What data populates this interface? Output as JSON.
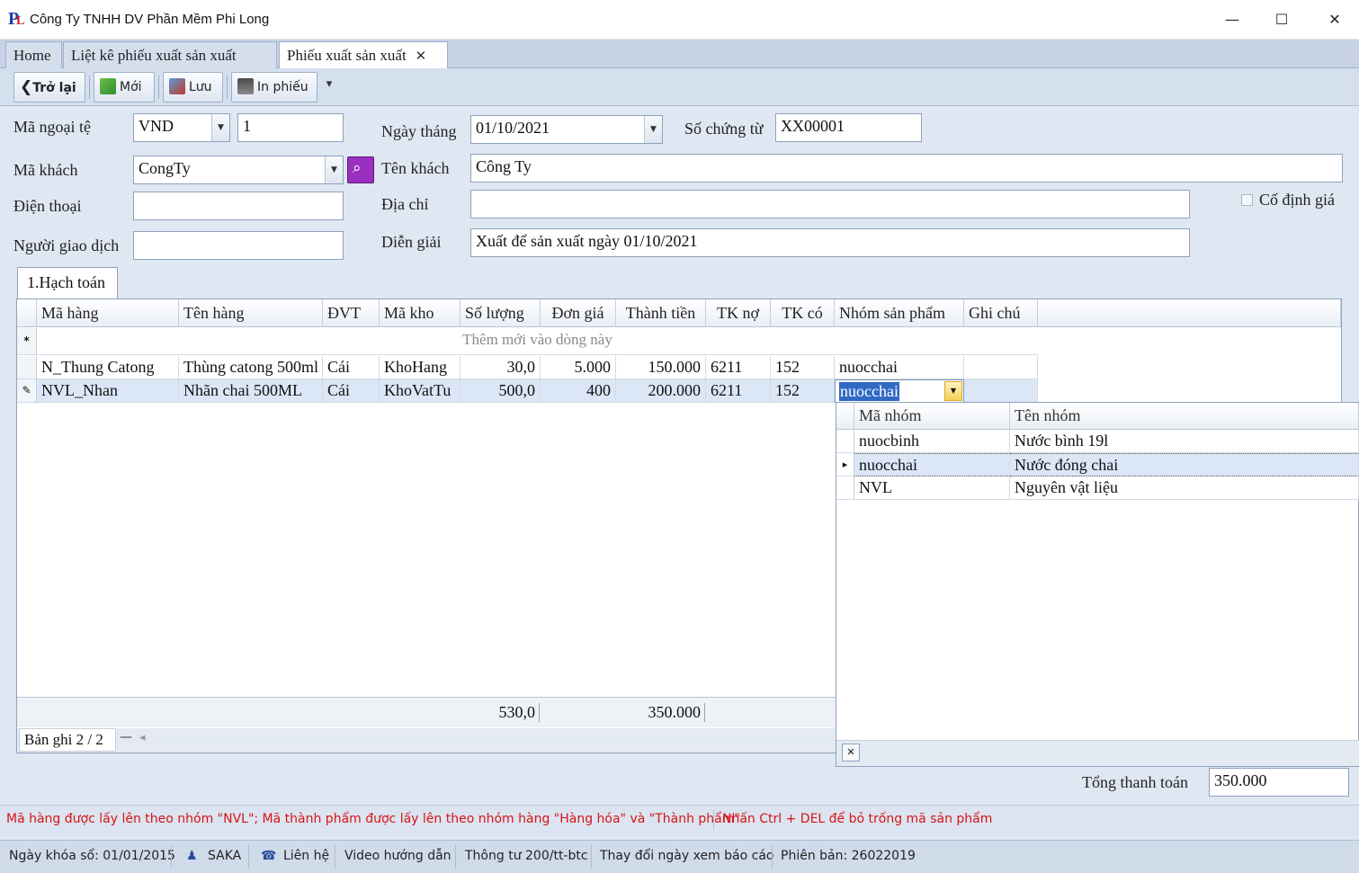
{
  "window": {
    "title": "Công Ty TNHH DV Phần Mềm Phi Long",
    "minimize": "—",
    "maximize": "☐",
    "close": "✕"
  },
  "tabs": [
    {
      "label": "Home"
    },
    {
      "label": "Liệt kê phiếu xuất sản xuất"
    },
    {
      "label": "Phiếu xuất sản xuất",
      "close": "✕"
    }
  ],
  "toolbar": {
    "back": "Trở lại",
    "new": "Mới",
    "save": "Lưu",
    "print": "In phiếu",
    "more": "▾"
  },
  "form": {
    "currency_label": "Mã ngoại tệ",
    "currency_value": "VND",
    "rate_value": "1",
    "date_label": "Ngày tháng",
    "date_value": "01/10/2021",
    "voucher_label": "Số chứng từ",
    "voucher_value": "XX00001",
    "customer_code_label": "Mã khách",
    "customer_code_value": "CongTy",
    "customer_name_label": "Tên khách",
    "customer_name_value": "Công Ty",
    "phone_label": "Điện thoại",
    "phone_value": "",
    "address_label": "Địa chỉ",
    "address_value": "",
    "fixed_price_label": "Cố định giá",
    "contact_label": "Người giao dịch",
    "contact_value": "",
    "description_label": "Diễn giải",
    "description_value": "Xuất để sản xuất ngày 01/10/2021"
  },
  "subtab": {
    "label": "1.Hạch toán"
  },
  "grid": {
    "columns": [
      "Mã hàng",
      "Tên hàng",
      "ĐVT",
      "Mã kho",
      "Số lượng",
      "Đơn giá",
      "Thành tiền",
      "TK nợ",
      "TK có",
      "Nhóm sản phẩm",
      "Ghi chú"
    ],
    "new_row_text": "Thêm mới vào dòng này",
    "new_row_marker": "*",
    "rows": [
      {
        "ma_hang": "N_Thung Catong",
        "ten_hang": "Thùng catong 500ml",
        "dvt": "Cái",
        "ma_kho": "KhoHang",
        "so_luong": "30,0",
        "don_gia": "5.000",
        "thanh_tien": "150.000",
        "tk_no": "6211",
        "tk_co": "152",
        "nhom": "nuocchai",
        "ghi_chu": ""
      },
      {
        "ma_hang": "NVL_Nhan",
        "ten_hang": "Nhãn chai 500ML",
        "dvt": "Cái",
        "ma_kho": "KhoVatTu",
        "so_luong": "500,0",
        "don_gia": "400",
        "thanh_tien": "200.000",
        "tk_no": "6211",
        "tk_co": "152",
        "nhom": "nuocchai",
        "ghi_chu": ""
      }
    ],
    "edit_marker": "✎",
    "total_quantity": "530,0",
    "total_amount": "350.000",
    "record_label": "Bản ghi 2 / 2",
    "nav_dash": "—",
    "nav_arrow": "◂"
  },
  "popup": {
    "columns": [
      "Mã nhóm",
      "Tên nhóm"
    ],
    "rows": [
      {
        "code": "nuocbinh",
        "name": "Nước bình 19l"
      },
      {
        "code": "nuocchai",
        "name": "Nước đóng chai"
      },
      {
        "code": "NVL",
        "name": "Nguyên vật liệu"
      }
    ],
    "current_marker": "▸",
    "close": "✕"
  },
  "total": {
    "label": "Tổng thanh toán",
    "value": "350.000"
  },
  "messages": {
    "m1": "Mã hàng được lấy lên theo nhóm \"NVL\"; Mã thành phẩm được lấy lên theo nhóm hàng \"Hàng hóa\" và \"Thành phẩm\"",
    "m2": "Nhấn Ctrl + DEL để bỏ trống mã sản phẩm"
  },
  "status": {
    "lock_date": "Ngày khóa sổ: 01/01/2015",
    "user": "SAKA",
    "contact": "Liên hệ",
    "video": "Video hướng dẫn",
    "circular": "Thông tư 200/tt-btc",
    "change_date": "Thay đổi ngày xem báo cáo",
    "version": "Phiên bản: 26022019"
  },
  "colors": {
    "accent": "#316ac5",
    "message": "#d81414",
    "selected_row": "#dbe6f6"
  }
}
